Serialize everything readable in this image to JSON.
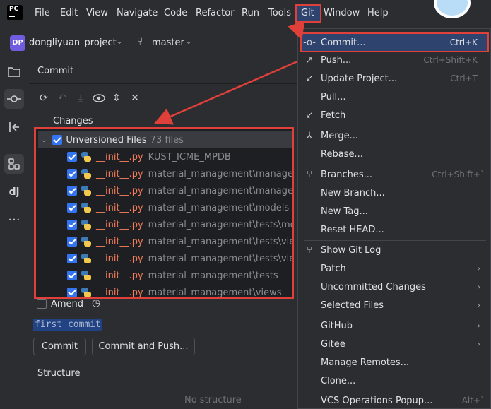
{
  "menubar": {
    "logo_text": "PC",
    "items": [
      "File",
      "Edit",
      "View",
      "Navigate",
      "Code",
      "Refactor",
      "Run",
      "Tools",
      "Git",
      "Window",
      "Help"
    ]
  },
  "project": {
    "badge": "DP",
    "name": "dongliyuan_project",
    "branch": "master"
  },
  "commit_panel": {
    "title": "Commit",
    "changes_label": "Changes",
    "group_label": "Unversioned Files",
    "group_count": "73 files",
    "files": [
      {
        "name": "__init__.py",
        "path": "KUST_ICME_MPDB"
      },
      {
        "name": "__init__.py",
        "path": "material_management\\management"
      },
      {
        "name": "__init__.py",
        "path": "material_management\\management"
      },
      {
        "name": "__init__.py",
        "path": "material_management\\models"
      },
      {
        "name": "__init__.py",
        "path": "material_management\\tests\\models"
      },
      {
        "name": "__init__.py",
        "path": "material_management\\tests\\views"
      },
      {
        "name": "__init__.py",
        "path": "material_management\\tests\\views"
      },
      {
        "name": "__init__.py",
        "path": "material_management\\tests"
      },
      {
        "name": "__init__.py",
        "path": "material_management\\views"
      }
    ],
    "amend_label": "Amend",
    "message": "first commit",
    "commit_button": "Commit",
    "commit_push_button": "Commit and Push...",
    "structure_title": "Structure",
    "structure_empty": "No structure"
  },
  "git_menu": {
    "items": [
      {
        "label": "Commit...",
        "shortcut": "Ctrl+K",
        "icon": "commit-icon"
      },
      {
        "label": "Push...",
        "shortcut": "Ctrl+Shift+K",
        "icon": "push-arrow-icon"
      },
      {
        "label": "Update Project...",
        "shortcut": "Ctrl+T",
        "icon": "update-arrow-icon"
      },
      {
        "label": "Pull...",
        "shortcut": ""
      },
      {
        "label": "Fetch",
        "shortcut": "",
        "icon": "fetch-icon"
      },
      {
        "label": "Merge...",
        "shortcut": "",
        "icon": "merge-icon"
      },
      {
        "label": "Rebase...",
        "shortcut": ""
      },
      {
        "label": "Branches...",
        "shortcut": "Ctrl+Shift+`",
        "icon": "branch-icon"
      },
      {
        "label": "New Branch...",
        "shortcut": ""
      },
      {
        "label": "New Tag...",
        "shortcut": ""
      },
      {
        "label": "Reset HEAD...",
        "shortcut": ""
      },
      {
        "label": "Show Git Log",
        "shortcut": "",
        "icon": "git-log-icon"
      },
      {
        "label": "Patch",
        "shortcut": "",
        "submenu": true
      },
      {
        "label": "Uncommitted Changes",
        "shortcut": "",
        "submenu": true
      },
      {
        "label": "Selected Files",
        "shortcut": "",
        "submenu": true
      },
      {
        "label": "GitHub",
        "shortcut": "",
        "submenu": true
      },
      {
        "label": "Gitee",
        "shortcut": "",
        "submenu": true
      },
      {
        "label": "Manage Remotes...",
        "shortcut": ""
      },
      {
        "label": "Clone...",
        "shortcut": ""
      },
      {
        "label": "VCS Operations Popup...",
        "shortcut": "Alt+`"
      }
    ]
  },
  "colors": {
    "highlight_border": "#e0403a",
    "selected_menu_bg": "#2e436e",
    "accent": "#3574f0"
  }
}
